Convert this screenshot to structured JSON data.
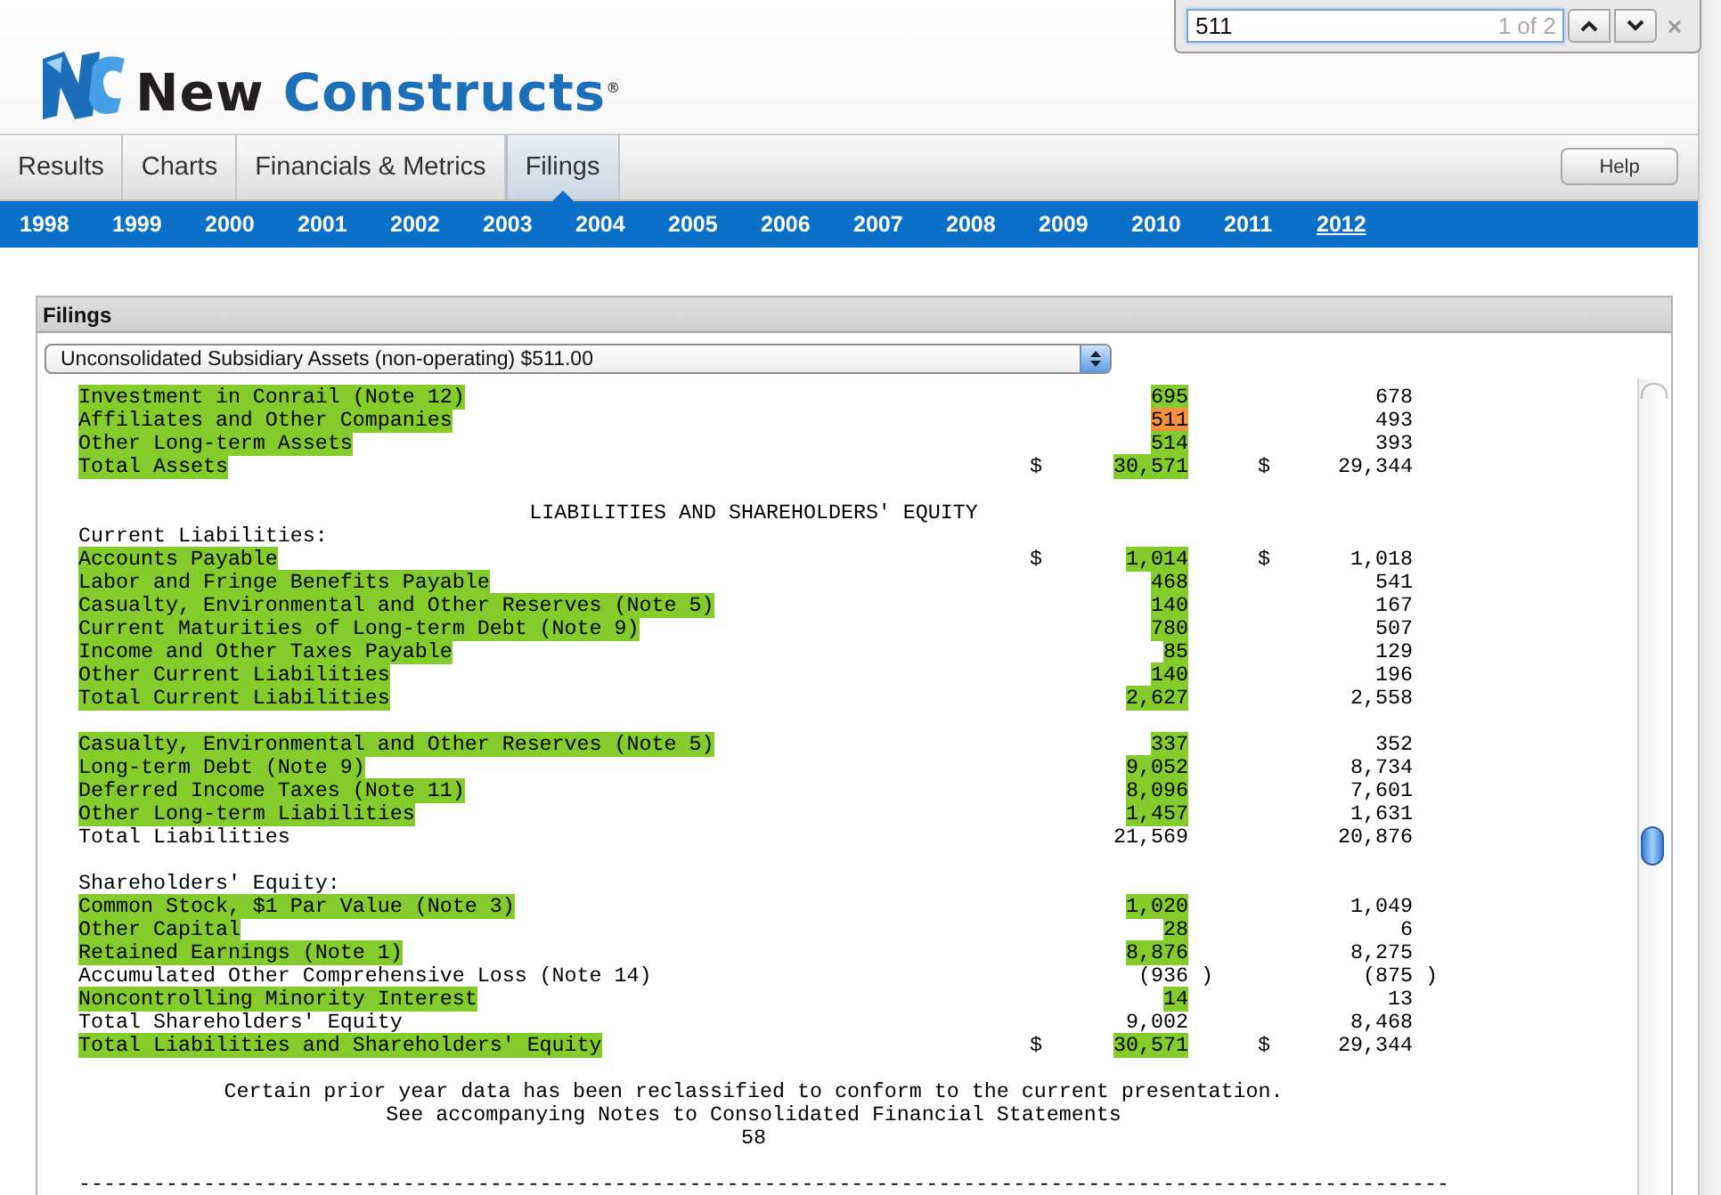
{
  "find_bar": {
    "value": "511",
    "match_count": "1 of 2"
  },
  "logo": {
    "text": "New **Constructs**$^{®}$"
  },
  "tabs": [
    {
      "label": "Results",
      "selected": false
    },
    {
      "label": "Charts",
      "selected": false
    },
    {
      "label": "Financials & Metrics",
      "selected": false
    },
    {
      "label": "Filings",
      "selected": true
    }
  ],
  "help_button": "Help",
  "years": [
    {
      "label": "1998",
      "selected": false
    },
    {
      "label": "1999",
      "selected": false
    },
    {
      "label": "2000",
      "selected": false
    },
    {
      "label": "2001",
      "selected": false
    },
    {
      "label": "2002",
      "selected": false
    },
    {
      "label": "2003",
      "selected": false
    },
    {
      "label": "2004",
      "selected": false
    },
    {
      "label": "2005",
      "selected": false
    },
    {
      "label": "2006",
      "selected": false
    },
    {
      "label": "2007",
      "selected": false
    },
    {
      "label": "2008",
      "selected": false
    },
    {
      "label": "2009",
      "selected": false
    },
    {
      "label": "2010",
      "selected": false
    },
    {
      "label": "2011",
      "selected": false
    },
    {
      "label": "2012",
      "selected": true
    }
  ],
  "panel": {
    "title": "Filings",
    "dropdown": "Unconsolidated Subsidiary Assets (non-operating) $511.00"
  },
  "document": [
    {
      "kind": "line",
      "label": "Investment in Conrail (Note 12)",
      "label_highlight": true,
      "current": "695",
      "value_highlight": true,
      "active_match": false,
      "prior": "678"
    },
    {
      "kind": "line",
      "label": "Affiliates and Other Companies",
      "label_highlight": true,
      "current": "511",
      "value_highlight": true,
      "active_match": true,
      "prior": "493"
    },
    {
      "kind": "line",
      "label": "Other Long-term Assets",
      "label_highlight": true,
      "current": "514",
      "value_highlight": true,
      "active_match": false,
      "prior": "393"
    },
    {
      "kind": "line",
      "label": "Total Assets",
      "label_highlight": true,
      "dollar_current": "$",
      "current": "30,571",
      "value_highlight": true,
      "active_match": false,
      "dollar_prior": "$",
      "prior": "29,344"
    },
    {
      "kind": "blank"
    },
    {
      "kind": "centered",
      "text": "LIABILITIES AND SHAREHOLDERS' EQUITY"
    },
    {
      "kind": "line",
      "label": "Current Liabilities:",
      "label_highlight": false
    },
    {
      "kind": "line",
      "label": "Accounts Payable",
      "label_highlight": true,
      "dollar_current": "$",
      "current": "1,014",
      "value_highlight": true,
      "active_match": false,
      "dollar_prior": "$",
      "prior": "1,018"
    },
    {
      "kind": "line",
      "label": "Labor and Fringe Benefits Payable",
      "label_highlight": true,
      "current": "468",
      "value_highlight": true,
      "active_match": false,
      "prior": "541"
    },
    {
      "kind": "line",
      "label": "Casualty, Environmental and Other Reserves (Note 5)",
      "label_highlight": true,
      "current": "140",
      "value_highlight": true,
      "active_match": false,
      "prior": "167"
    },
    {
      "kind": "line",
      "label": "Current Maturities of Long-term Debt (Note 9)",
      "label_highlight": true,
      "current": "780",
      "value_highlight": true,
      "active_match": false,
      "prior": "507"
    },
    {
      "kind": "line",
      "label": "Income and Other Taxes Payable",
      "label_highlight": true,
      "current": "85",
      "value_highlight": true,
      "active_match": false,
      "prior": "129"
    },
    {
      "kind": "line",
      "label": "Other Current Liabilities",
      "label_highlight": true,
      "current": "140",
      "value_highlight": true,
      "active_match": false,
      "prior": "196"
    },
    {
      "kind": "line",
      "label": "Total Current Liabilities",
      "label_highlight": true,
      "current": "2,627",
      "value_highlight": true,
      "active_match": false,
      "prior": "2,558"
    },
    {
      "kind": "blank"
    },
    {
      "kind": "line",
      "label": "Casualty, Environmental and Other Reserves (Note 5)",
      "label_highlight": true,
      "current": "337",
      "value_highlight": true,
      "active_match": false,
      "prior": "352"
    },
    {
      "kind": "line",
      "label": "Long-term Debt (Note 9)",
      "label_highlight": true,
      "current": "9,052",
      "value_highlight": true,
      "active_match": false,
      "prior": "8,734"
    },
    {
      "kind": "line",
      "label": "Deferred Income Taxes (Note 11)",
      "label_highlight": true,
      "current": "8,096",
      "value_highlight": true,
      "active_match": false,
      "prior": "7,601"
    },
    {
      "kind": "line",
      "label": "Other Long-term Liabilities",
      "label_highlight": true,
      "current": "1,457",
      "value_highlight": true,
      "active_match": false,
      "prior": "1,631"
    },
    {
      "kind": "line",
      "label": "Total Liabilities",
      "label_highlight": false,
      "current": "21,569",
      "value_highlight": false,
      "active_match": false,
      "prior": "20,876"
    },
    {
      "kind": "blank"
    },
    {
      "kind": "line",
      "label": "Shareholders' Equity:",
      "label_highlight": false
    },
    {
      "kind": "line",
      "label": "Common Stock, $1 Par Value (Note 3)",
      "label_highlight": true,
      "current": "1,020",
      "value_highlight": true,
      "active_match": false,
      "prior": "1,049"
    },
    {
      "kind": "line",
      "label": "Other Capital",
      "label_highlight": true,
      "current": "28",
      "value_highlight": true,
      "active_match": false,
      "prior": "6"
    },
    {
      "kind": "line",
      "label": "Retained Earnings (Note 1)",
      "label_highlight": true,
      "current": "8,876",
      "value_highlight": true,
      "active_match": false,
      "prior": "8,275"
    },
    {
      "kind": "line",
      "label": "Accumulated Other Comprehensive Loss (Note 14)",
      "label_highlight": false,
      "current": "(936 )",
      "value_highlight": false,
      "active_match": false,
      "prior": "(875 )",
      "hanging_paren": true
    },
    {
      "kind": "line",
      "label": "Noncontrolling Minority Interest",
      "label_highlight": true,
      "current": "14",
      "value_highlight": true,
      "active_match": false,
      "prior": "13"
    },
    {
      "kind": "line",
      "label": "Total Shareholders' Equity",
      "label_highlight": false,
      "current": "9,002",
      "value_highlight": false,
      "active_match": false,
      "prior": "8,468"
    },
    {
      "kind": "line",
      "label": "Total Liabilities and Shareholders' Equity",
      "label_highlight": true,
      "dollar_current": "$",
      "current": "30,571",
      "value_highlight": true,
      "active_match": false,
      "dollar_prior": "$",
      "prior": "29,344"
    },
    {
      "kind": "blank"
    },
    {
      "kind": "centered",
      "text": "Certain prior year data has been reclassified to conform to the current presentation."
    },
    {
      "kind": "centered",
      "text": "See accompanying Notes to Consolidated Financial Statements"
    },
    {
      "kind": "centered",
      "text": "58"
    },
    {
      "kind": "blank"
    },
    {
      "kind": "plain",
      "text": "--------------------------------------------------------------------------------------------------------------"
    }
  ]
}
